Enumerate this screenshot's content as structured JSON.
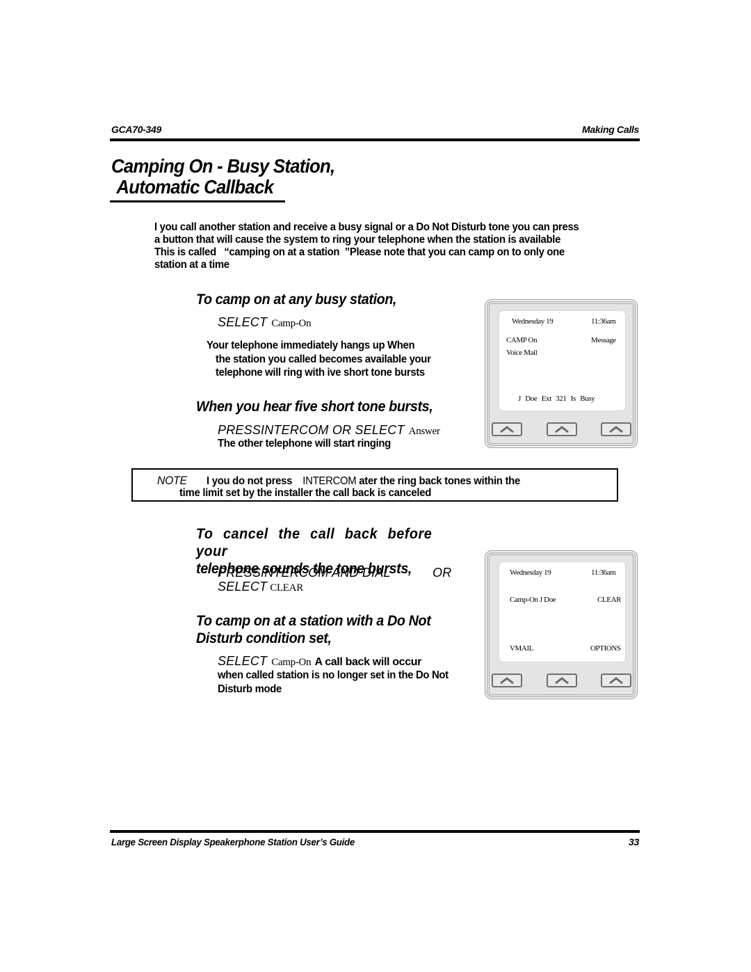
{
  "header": {
    "doc_id": "GCA70-349",
    "section": "Making Calls"
  },
  "title": {
    "line1": "Camping On - Busy Station,",
    "line2": "Automatic Callback"
  },
  "intro": "I you call another station and receive a busy signal or a Do Not Disturb tone you can press a button that will cause the system to ring your telephone when the station is available This is called   “camping on at a station  ”Please note that you can camp on to only one station at a time",
  "sections": [
    {
      "heading": "To camp on at any busy station,",
      "command": {
        "verb": "SELECT",
        "key": "Camp-On"
      },
      "body_first": "Your telephone immediately hangs up When",
      "body_rest": "the station you called becomes available your telephone will ring with ive short tone bursts"
    },
    {
      "heading": "When you hear five short tone bursts,",
      "command": {
        "verb": "PRESSINTERCOM OR SELECT",
        "key": "Answer"
      },
      "body": "The other telephone will start ringing"
    },
    {
      "heading_line1": "To cancel the call back before your",
      "heading_line2": "telephone sounds the tone bursts,",
      "command1": {
        "verb": "PRESSINTERCOM AND DIAL"
      },
      "or_label": "OR",
      "command2": {
        "verb": "SELECT",
        "key": "CLEAR"
      }
    },
    {
      "heading_line1": "To camp on at a station with a Do Not",
      "heading_line2": "Disturb condition set,",
      "command": {
        "verb": "SELECT",
        "key": "Camp-On"
      },
      "inline_text": "A call back will occur",
      "body": "when called station is no longer set in the Do Not Disturb mode"
    }
  ],
  "note": {
    "label": "NOTE",
    "text_a": "I you do not press",
    "key": "INTERCOM",
    "text_b": "ater the ring back tones within the",
    "line2": "time limit set by the installer the call back is canceled"
  },
  "displays": [
    {
      "date": "Wednesday 19",
      "time": "11:36am",
      "left_top": "CAMP On",
      "right_top": "Message",
      "left_2": "Voice Mail",
      "status": "J Doe Ext 321 Is Busy",
      "softkeys": [
        "softkey-1",
        "softkey-2",
        "softkey-3"
      ]
    },
    {
      "date": "Wednesday 19",
      "time": "11:36am",
      "left_top": "Camp-On J Doe",
      "right_top": "CLEAR",
      "left_bottom": "VMAIL",
      "right_bottom": "OPTIONS",
      "softkeys": [
        "softkey-1",
        "softkey-2",
        "softkey-3"
      ]
    }
  ],
  "footer": {
    "guide_title": "Large Screen Display Speakerphone Station User’s Guide",
    "page_number": "33"
  }
}
